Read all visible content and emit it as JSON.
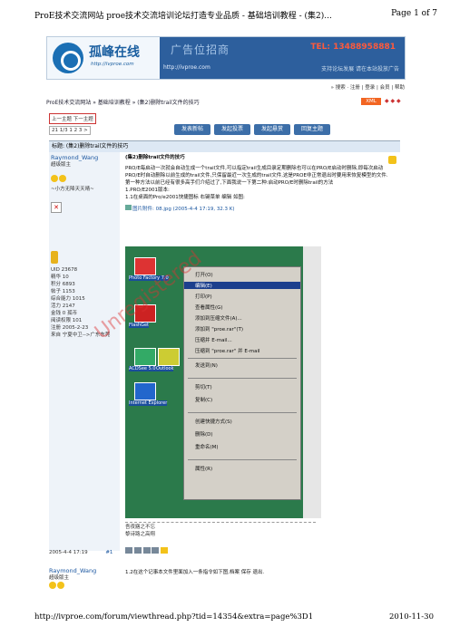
{
  "pdf_header": {
    "title": "ProE技术交流网站  proe技术交流培训论坛打造专业品质  - 基础培训教程  - (集2)...",
    "page": "Page 1 of 7"
  },
  "logo": {
    "name": "孤峰在线",
    "url": "http://ivproe.com"
  },
  "ad": {
    "text": "广告位招商",
    "phone": "TEL: 13488958881",
    "sub_left": "http://ivproe.com",
    "sub_right": "支持论坛发展 请在本站投放广告"
  },
  "toplinks": "» 搜索 · 注册 | 登录 | 会员 | 帮助",
  "breadcrumb": "ProE技术交流网站 » 基础培训教程 » (集2)删除trail文件的技巧",
  "xml_label": "XML",
  "nav_arrows": "◆ ◆ ◆",
  "prevnext": "上一主题  下一主题",
  "pager": "21  1/3  1  2  3  >",
  "buttons": [
    "发表新帖",
    "发起投票",
    "发起悬赏",
    "回复主题"
  ],
  "thread_title": "标题: (集2)删除trail文件的技巧",
  "post1": {
    "author": "Raymond_Wang",
    "role": "超级版主",
    "quote": "~小方无降天天晴~",
    "stats": [
      "UID 23678",
      "精华 10",
      "积分 6893",
      "帖子 1153",
      "综合能力 1015",
      "活力 2147",
      "金钱 0 孤币",
      "阅读权限 101",
      "注册 2005-2-23",
      "来自 宁夏中卫-->广东东莞"
    ],
    "title": "(集2)删除trail文件的技巧",
    "para1": "PRO/E每启动一次就会自动生成一个trail文件,可以指定trail生成目录定期删除也可以在PRO/E启动时删除,即每次启动PRO/E时自动删除以前生成的trail文件,只保留最近一次生成的trail文件,这是PROE非正常退出时要用来恢复模型的文件.",
    "para2": "第一种方法以前已经有很多高手们介绍过了,下面我说一下第二种:启动PRO/E时删除trail的方法",
    "para3": "1.PRO/E2001版本:",
    "para4": "1.1在桌面的Pro/e2001快捷图标  右键菜单   编辑  如图:",
    "attachment": "图片附件: 08.jpg (2005-4-4 17:19, 32.3 K)",
    "signature1": "吾夜寤之不忘",
    "signature2": "黎诗路之高翔",
    "time": "2005-4-4 17:19",
    "floor": "#1"
  },
  "context_menu": [
    "打开(O)",
    "编辑(E)",
    "打印(P)",
    "查看属性(G)",
    "添加到压缩文件(A)...",
    "添加到 \"proe.rar\"(T)",
    "压缩并 E-mail...",
    "压缩到 \"proe.rar\" 并 E-mail",
    "发送到(N)",
    "剪切(T)",
    "复制(C)",
    "创建快捷方式(S)",
    "删除(D)",
    "重命名(M)",
    "属性(R)"
  ],
  "desktop_icons": [
    "Photo Factory 7.0",
    "FlashGet",
    "ACDSee 5.0",
    "Internet Explorer",
    "Outlook"
  ],
  "watermark": "Unregistered",
  "post2": {
    "author": "Raymond_Wang",
    "role": "超级版主",
    "body": "1.2在这个记事本文件里面加入一条指令如下图,档案   保存   退出."
  },
  "pdf_footer": {
    "url": "http://ivproe.com/forum/viewthread.php?tid=14354&extra=page%3D1",
    "date": "2010-11-30"
  }
}
